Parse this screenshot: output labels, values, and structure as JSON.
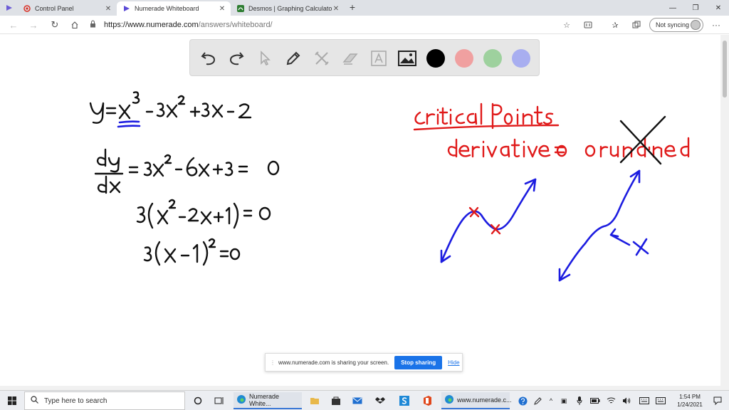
{
  "browser": {
    "tabs": [
      {
        "title": "Control Panel",
        "active": false
      },
      {
        "title": "Numerade Whiteboard",
        "active": true
      },
      {
        "title": "Desmos | Graphing Calculator",
        "active": false
      }
    ],
    "url_prefix": "https://www.numerade.com",
    "url_path": "/answers/whiteboard/",
    "sync_label": "Not syncing"
  },
  "toolbar": {
    "tools": [
      "undo-icon",
      "redo-icon",
      "pointer-icon",
      "pen-icon",
      "tools-icon",
      "eraser-icon",
      "text-icon",
      "image-icon"
    ],
    "colors": [
      "#000000",
      "#f0a0a0",
      "#9ed19e",
      "#a8aef0"
    ]
  },
  "whiteboard": {
    "black_ink": "#111111",
    "blue_ink": "#1c1ce0",
    "red_ink": "#e01a1a",
    "equations": [
      "y = x³ − 3x² + 3x − 2",
      "dy/dx = 3x² − 6x + 3 = 0",
      "3(x² − 2x + 1) = 0",
      "3(x − 1)² = 0"
    ],
    "notes": [
      "critical points",
      "derivative = 0 or undefined"
    ],
    "mark": "X"
  },
  "share": {
    "message": "www.numerade.com is sharing your screen.",
    "stop_label": "Stop sharing",
    "hide_label": "Hide"
  },
  "taskbar": {
    "search_placeholder": "Type here to search",
    "apps": [
      {
        "label": "Numerade White..."
      },
      {
        "label": "www.numerade.c..."
      }
    ],
    "time": "1:54 PM",
    "date": "1/24/2021"
  }
}
